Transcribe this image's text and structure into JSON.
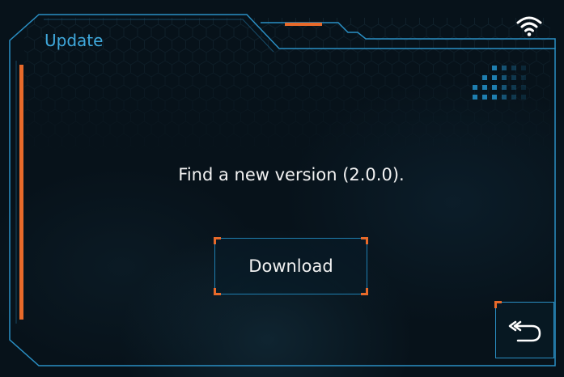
{
  "header": {
    "title": "Update",
    "wifi_icon": "wifi-icon"
  },
  "main": {
    "message": "Find a new version (2.0.0).",
    "download_label": "Download"
  },
  "footer": {
    "back_icon": "back-arrow-icon"
  },
  "colors": {
    "accent_blue": "#3fa9dd",
    "accent_orange": "#e86a2a",
    "background": "#07121a",
    "text": "#f2f2f2"
  }
}
